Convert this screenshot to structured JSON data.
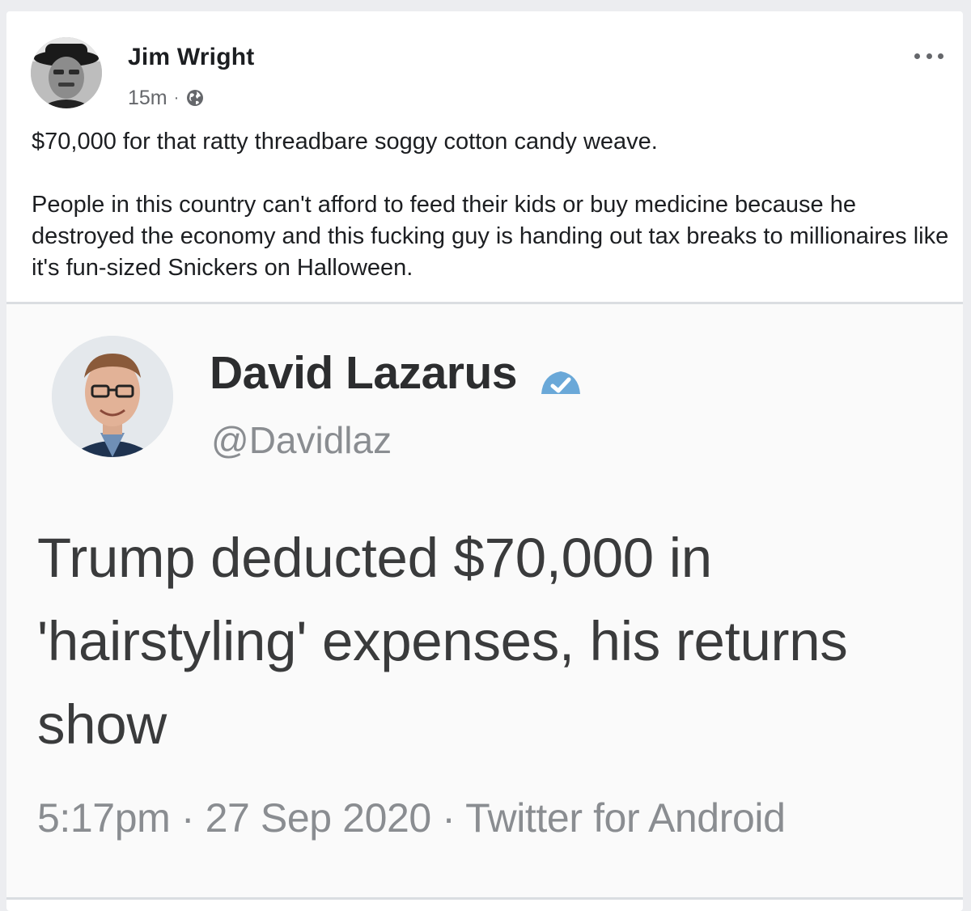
{
  "post": {
    "author": "Jim Wright",
    "time": "15m",
    "separator": "·",
    "privacy_icon": "globe-icon",
    "more_icon": "more-options-icon",
    "text_line1": "$70,000 for that ratty threadbare soggy cotton candy weave.",
    "text_para2": "People in this country can't afford to feed their kids or buy medicine because he destroyed the economy and this fucking guy is handing out tax breaks to millionaires like it's fun-sized Snickers on Halloween."
  },
  "shared_tweet": {
    "name": "David Lazarus",
    "verified_icon": "verified-badge-icon",
    "handle": "@Davidlaz",
    "body": "Trump deducted $70,000 in 'hairstyling' expenses, his returns show",
    "footer": "5:17pm · 27 Sep 2020 · Twitter for Android"
  },
  "colors": {
    "background": "#ecedf0",
    "card": "#ffffff",
    "text_primary": "#1c1e21",
    "text_secondary": "#65676b",
    "verified_blue": "#1da1f2"
  }
}
